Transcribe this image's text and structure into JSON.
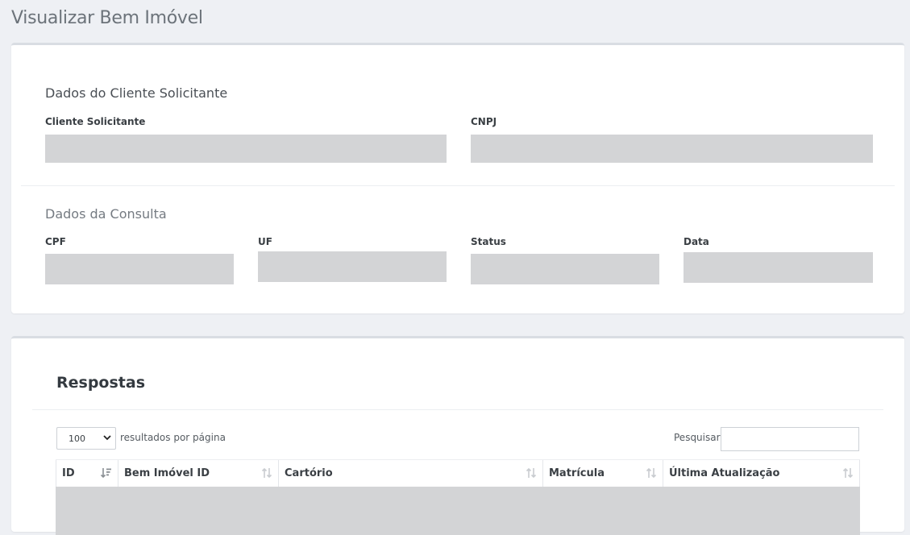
{
  "page": {
    "title": "Visualizar Bem Imóvel"
  },
  "client_section": {
    "title": "Dados do Cliente Solicitante",
    "fields": [
      {
        "label": "Cliente Solicitante",
        "value": ""
      },
      {
        "label": "CNPJ",
        "value": ""
      }
    ]
  },
  "query_section": {
    "title": "Dados da Consulta",
    "fields": [
      {
        "label": "CPF",
        "value": ""
      },
      {
        "label": "UF",
        "value": ""
      },
      {
        "label": "Status",
        "value": ""
      },
      {
        "label": "Data",
        "value": ""
      }
    ]
  },
  "responses": {
    "title": "Respostas",
    "page_size": {
      "selected": "100",
      "label": "resultados por página"
    },
    "search": {
      "label": "Pesquisar",
      "value": ""
    },
    "columns": [
      "ID",
      "Bem Imóvel ID",
      "Cartório",
      "Matrícula",
      "Última Atualização"
    ],
    "rows": []
  },
  "icons": {
    "sort_active": "sort-descending-icon",
    "sort_inactive": "sort-both-icon",
    "dropdown": "chevron-down-icon"
  },
  "colors": {
    "background": "#eef0f4",
    "card": "#ffffff",
    "placeholder": "#d3d4d6",
    "title": "#6c737a"
  }
}
